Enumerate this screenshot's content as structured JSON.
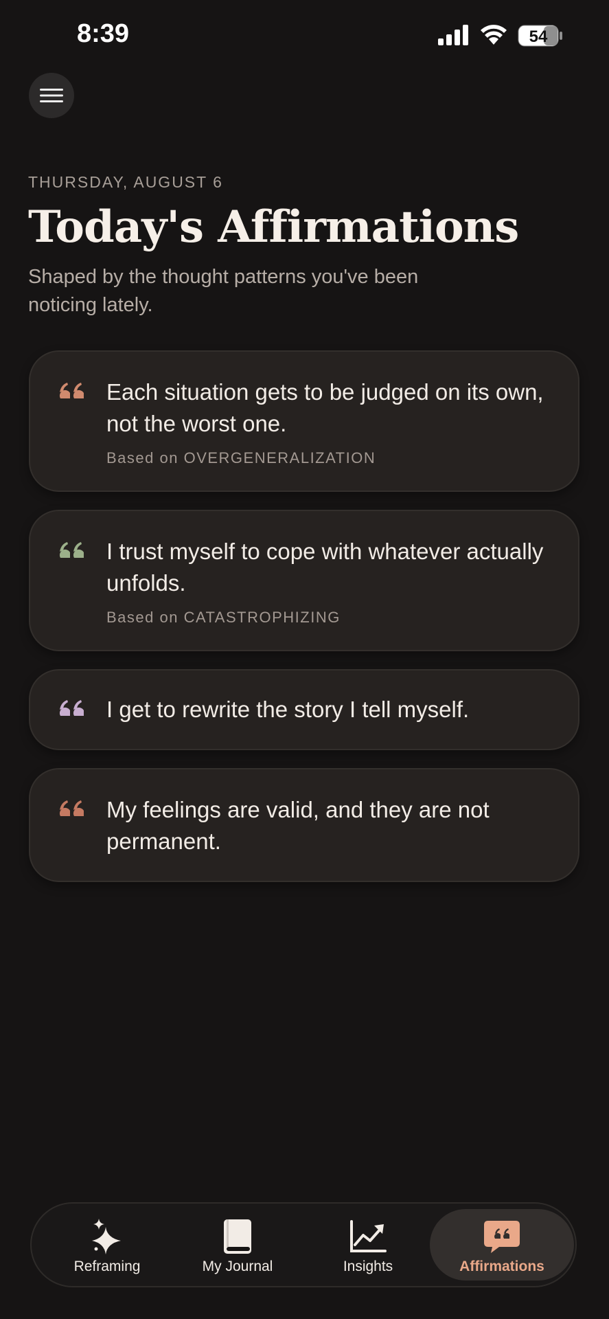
{
  "status_bar": {
    "time": "8:39",
    "battery_level": "54",
    "icons": [
      "cellular-signal-icon",
      "wifi-icon",
      "battery-icon"
    ]
  },
  "menu": {
    "icon": "hamburger-menu-icon"
  },
  "header": {
    "date": "THURSDAY, AUGUST 6",
    "title": "Today's Affirmations",
    "subtitle": "Shaped by the thought patterns you've been noticing lately."
  },
  "affirmations": [
    {
      "text": "Each situation gets to be judged on its own, not the worst one.",
      "basis": "Based on OVERGENERALIZATION",
      "quote_color": "#d08a6e"
    },
    {
      "text": "I trust myself to cope with whatever actually unfolds.",
      "basis": "Based on CATASTROPHIZING",
      "quote_color": "#9cb08a"
    },
    {
      "text": "I get to rewrite the story I tell myself.",
      "basis": "",
      "quote_color": "#c8aed0"
    },
    {
      "text": "My feelings are valid, and they are not permanent.",
      "basis": "",
      "quote_color": "#c57a62"
    }
  ],
  "tabs": [
    {
      "label": "Reframing",
      "icon": "sparkles-icon",
      "active": false
    },
    {
      "label": "My Journal",
      "icon": "book-icon",
      "active": false
    },
    {
      "label": "Insights",
      "icon": "trend-chart-icon",
      "active": false
    },
    {
      "label": "Affirmations",
      "icon": "quote-bubble-icon",
      "active": true
    }
  ],
  "colors": {
    "background": "#161414",
    "card": "#262220",
    "accent": "#e9a889"
  }
}
